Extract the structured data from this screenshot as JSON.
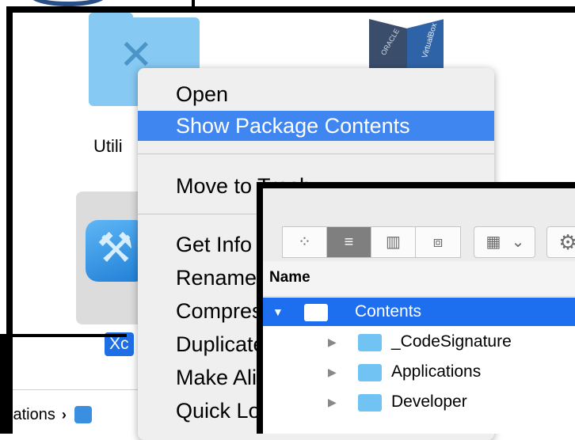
{
  "finder": {
    "utilities_label": "Utili",
    "virtualbox_face_left": "ORACLE",
    "virtualbox_face_right": "VirtualBox",
    "xcode_label": "Xc",
    "path_bar": {
      "segment": "ications",
      "separator": "›"
    }
  },
  "context_menu": {
    "items": [
      {
        "label": "Open",
        "highlighted": false
      },
      {
        "label": "Show Package Contents",
        "highlighted": true
      },
      {
        "label": "Move to Trash",
        "highlighted": false
      },
      {
        "label": "Get Info",
        "highlighted": false
      },
      {
        "label": "Rename",
        "highlighted": false
      },
      {
        "label": "Compress",
        "highlighted": false
      },
      {
        "label": "Duplicate",
        "highlighted": false
      },
      {
        "label": "Make Alias",
        "highlighted": false
      },
      {
        "label": "Quick Look",
        "highlighted": false
      }
    ]
  },
  "package_window": {
    "view_buttons": [
      {
        "icon": "icon-view-icon",
        "glyph": "⁘",
        "active": false
      },
      {
        "icon": "list-view-icon",
        "glyph": "≡",
        "active": true
      },
      {
        "icon": "column-view-icon",
        "glyph": "▥",
        "active": false
      },
      {
        "icon": "cover-flow-icon",
        "glyph": "⧈",
        "active": false
      }
    ],
    "arrange_glyph": "▦",
    "arrange_chevron": "⌄",
    "action_glyph": "⚙",
    "column_header": "Name",
    "rows": [
      {
        "name": "Contents",
        "expanded": true,
        "selected": true
      },
      {
        "name": "_CodeSignature",
        "expanded": false,
        "selected": false
      },
      {
        "name": "Applications",
        "expanded": false,
        "selected": false
      },
      {
        "name": "Developer",
        "expanded": false,
        "selected": false
      }
    ]
  },
  "colors": {
    "highlight": "#3f86f0",
    "selection": "#1d6ff0",
    "folder": "#70c3f2"
  }
}
